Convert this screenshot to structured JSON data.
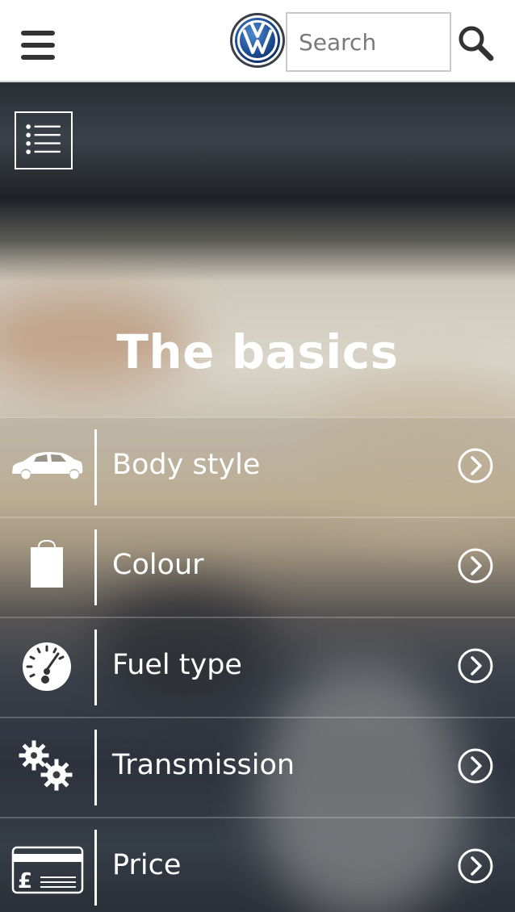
{
  "header": {
    "search": {
      "placeholder": "Search"
    }
  },
  "hero": {
    "title": "The basics"
  },
  "menu": {
    "items": [
      {
        "label": "Body style",
        "icon": "car-icon"
      },
      {
        "label": "Colour",
        "icon": "paint-can-icon"
      },
      {
        "label": "Fuel type",
        "icon": "fuel-gauge-icon"
      },
      {
        "label": "Transmission",
        "icon": "gears-icon"
      },
      {
        "label": "Price",
        "icon": "pound-card-icon"
      }
    ]
  },
  "colors": {
    "header_bg": "#ffffff",
    "text_light": "#ffffff",
    "icon_dark": "#333333",
    "vw_blue": "#1b3d7a"
  }
}
